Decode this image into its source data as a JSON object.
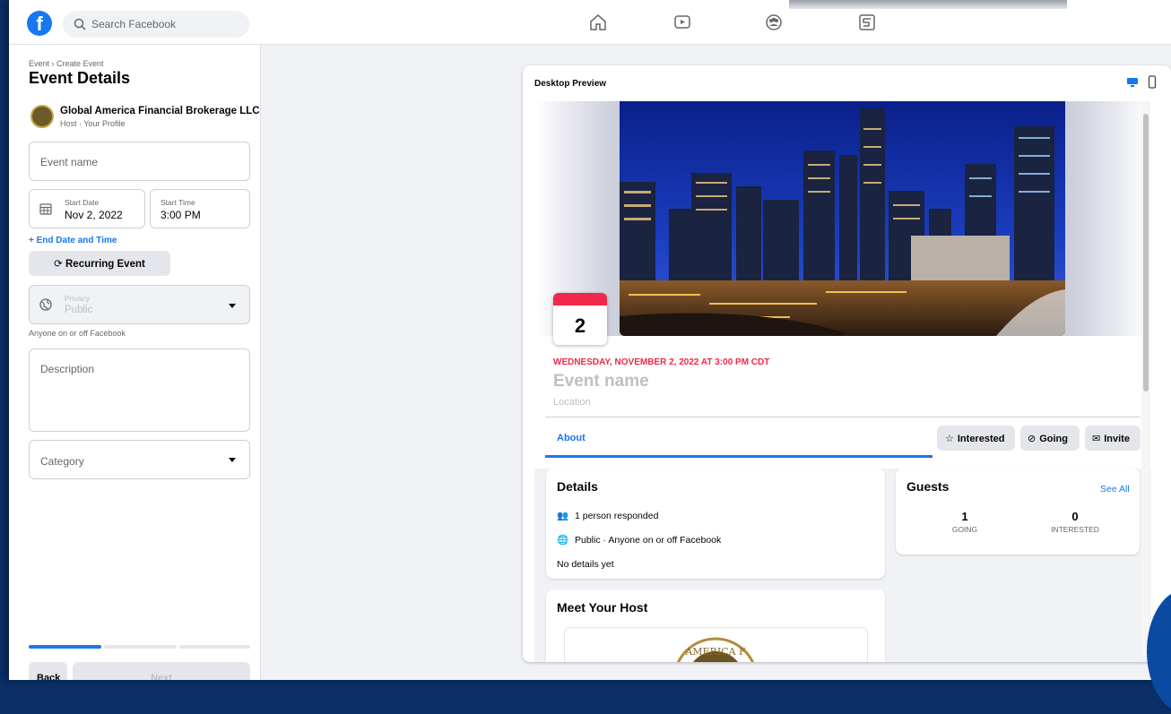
{
  "topbar": {
    "search_placeholder": "Search Facebook",
    "nav_icons": [
      "home-icon",
      "watch-icon",
      "groups-icon",
      "gaming-icon"
    ]
  },
  "left": {
    "breadcrumb": "Event › Create Event",
    "title": "Event Details",
    "host_name": "Global America Financial Brokerage LLC",
    "host_role": "Host · Your Profile",
    "event_name_placeholder": "Event name",
    "start_date_label": "Start Date",
    "start_date_value": "Nov 2, 2022",
    "start_time_label": "Start Time",
    "start_time_value": "3:00 PM",
    "end_date_link": "+ End Date and Time",
    "recurring_label": "Recurring Event",
    "privacy_label": "Privacy",
    "privacy_value": "Public",
    "privacy_helper": "Anyone on or off Facebook",
    "description_placeholder": "Description",
    "category_placeholder": "Category",
    "back_label": "Back",
    "next_label": "Next",
    "progress_step": 1,
    "progress_steps": 3
  },
  "preview": {
    "label": "Desktop Preview",
    "calendar_day": "2",
    "date_line": "WEDNESDAY, NOVEMBER 2, 2022 AT 3:00 PM CDT",
    "event_name": "Event name",
    "location": "Location",
    "tab_about": "About",
    "btn_interested": "Interested",
    "btn_going": "Going",
    "btn_invite": "Invite",
    "details_title": "Details",
    "details_responded": "1 person responded",
    "details_public": "Public · Anyone on or off Facebook",
    "details_none": "No details yet",
    "guests_title": "Guests",
    "guests_see_all": "See All",
    "going_count": "1",
    "going_label": "GOING",
    "interested_count": "0",
    "interested_label": "INTERESTED",
    "host_title": "Meet Your Host",
    "host_logo_text": "AMERICA F"
  },
  "colors": {
    "accent": "#1877f2",
    "date_red": "#f02849",
    "bg": "#f0f2f5"
  }
}
